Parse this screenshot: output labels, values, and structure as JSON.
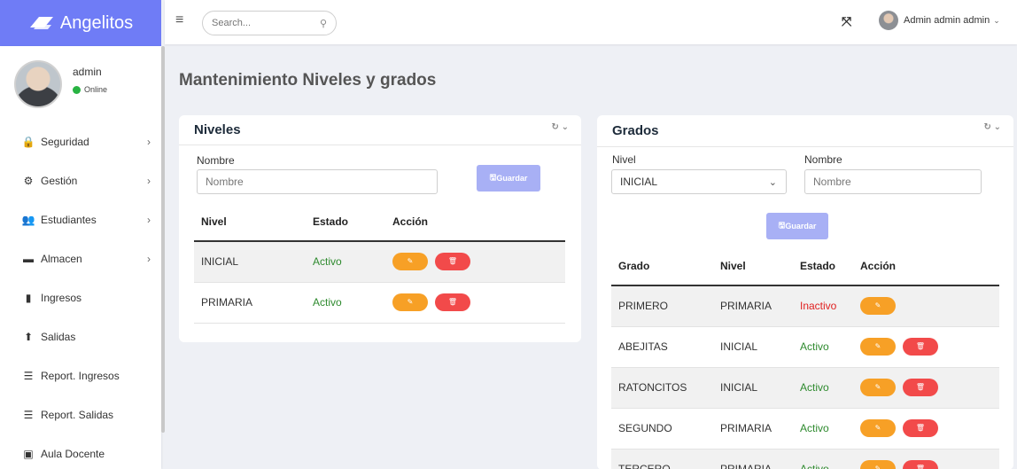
{
  "brand": {
    "name": "Angelitos"
  },
  "user": {
    "name": "admin",
    "status": "Online"
  },
  "menu": [
    {
      "label": "Seguridad",
      "icon": "lock-icon",
      "glyph": "🔒",
      "chevron": true
    },
    {
      "label": "Gestión",
      "icon": "gears-icon",
      "glyph": "⚙",
      "chevron": true
    },
    {
      "label": "Estudiantes",
      "icon": "users-icon",
      "glyph": "👥",
      "chevron": true
    },
    {
      "label": "Almacen",
      "icon": "archive-icon",
      "glyph": "▬",
      "chevron": true
    },
    {
      "label": "Ingresos",
      "icon": "file-icon",
      "glyph": "▮",
      "chevron": false
    },
    {
      "label": "Salidas",
      "icon": "upload-icon",
      "glyph": "⬆",
      "chevron": false
    },
    {
      "label": "Report. Ingresos",
      "icon": "list-icon",
      "glyph": "☰",
      "chevron": false
    },
    {
      "label": "Report. Salidas",
      "icon": "list-icon",
      "glyph": "☰",
      "chevron": false
    },
    {
      "label": "Aula Docente",
      "icon": "briefcase-icon",
      "glyph": "▣",
      "chevron": false
    }
  ],
  "topbar": {
    "search_placeholder": "Search...",
    "admin_name": "Admin admin admin"
  },
  "page_title": "Mantenimiento Niveles y grados",
  "niveles": {
    "title": "Niveles",
    "label_nombre": "Nombre",
    "input_placeholder": "Nombre",
    "save_label": "Guardar",
    "headers": [
      "Nivel",
      "Estado",
      "Acción"
    ],
    "rows": [
      {
        "nivel": "INICIAL",
        "estado": "Activo",
        "active": true
      },
      {
        "nivel": "PRIMARIA",
        "estado": "Activo",
        "active": true
      }
    ]
  },
  "grados": {
    "title": "Grados",
    "label_nivel": "Nivel",
    "label_nombre": "Nombre",
    "select_value": "INICIAL",
    "input_placeholder": "Nombre",
    "save_label": "Guardar",
    "headers": [
      "Grado",
      "Nivel",
      "Estado",
      "Acción"
    ],
    "rows": [
      {
        "grado": "PRIMERO",
        "nivel": "PRIMARIA",
        "estado": "Inactivo",
        "active": false
      },
      {
        "grado": "ABEJITAS",
        "nivel": "INICIAL",
        "estado": "Activo",
        "active": true
      },
      {
        "grado": "RATONCITOS",
        "nivel": "INICIAL",
        "estado": "Activo",
        "active": true
      },
      {
        "grado": "SEGUNDO",
        "nivel": "PRIMARIA",
        "estado": "Activo",
        "active": true
      },
      {
        "grado": "TERCERO",
        "nivel": "PRIMARIA",
        "estado": "Activo",
        "active": true
      }
    ]
  },
  "colors": {
    "brand": "#6f7cf6",
    "edit": "#f7a026",
    "delete": "#f24a4a",
    "active": "#2e8a2e",
    "inactive": "#e02020",
    "save": "#a8b0f5"
  }
}
